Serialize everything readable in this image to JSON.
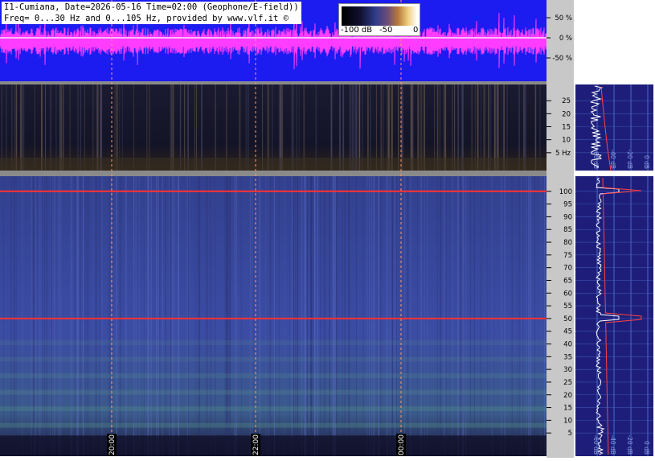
{
  "header": {
    "line1": "I1-Cumiana, Date=2026-05-16 Time=02:00 (Geophone/E-field))",
    "line2": "Freq= 0...30 Hz and 0...105 Hz, provided by www.vlf.it ©"
  },
  "colorbar": {
    "labels": [
      "-100 dB",
      "-50",
      "0"
    ]
  },
  "colors": {
    "waveform_bg": "#1c1cf0",
    "waveform": "#ff3cff",
    "spectro_low_bg": "#151528",
    "spectro_high_bg": "#3a4aa0",
    "axis_bg": "#c8c8c8",
    "profile_bg": "#1e1e7a",
    "time_marker": "#ff9a6a",
    "line_50hz": "#ff3030"
  },
  "chart_data": [
    {
      "type": "area",
      "panel": "waveform",
      "y_ticks": [
        "50 %",
        "0 %",
        "-50 %"
      ],
      "ylim": [
        -100,
        100
      ]
    },
    {
      "type": "heatmap",
      "panel": "spectrogram_low",
      "ylim": [
        0,
        30
      ],
      "y_ticks": [
        {
          "value": 25,
          "label": "25"
        },
        {
          "value": 20,
          "label": "20"
        },
        {
          "value": 15,
          "label": "15"
        },
        {
          "value": 10,
          "label": "10"
        },
        {
          "value": 5,
          "label": "5 Hz"
        }
      ],
      "x_ticks": [
        "20:00",
        "22:00",
        "00:00"
      ]
    },
    {
      "type": "heatmap",
      "panel": "spectrogram_high",
      "ylim": [
        0,
        105
      ],
      "y_ticks": [
        100,
        95,
        90,
        85,
        80,
        75,
        70,
        65,
        60,
        55,
        50,
        45,
        40,
        35,
        30,
        25,
        20,
        15,
        10,
        5
      ],
      "x_ticks": [
        "20:00",
        "22:00",
        "00:00"
      ],
      "features": [
        {
          "name": "100 Hz line",
          "freq": 100
        },
        {
          "name": "50 Hz line",
          "freq": 50
        }
      ]
    },
    {
      "type": "line",
      "panel": "spectrum_profile",
      "x_ticks": [
        "-60 dB",
        "-40 dB",
        "-20 dB",
        "0 dB"
      ],
      "x_ticks_low": [
        "-60 dB",
        "-40 dB",
        "-20 dB",
        "0 dB"
      ]
    }
  ]
}
